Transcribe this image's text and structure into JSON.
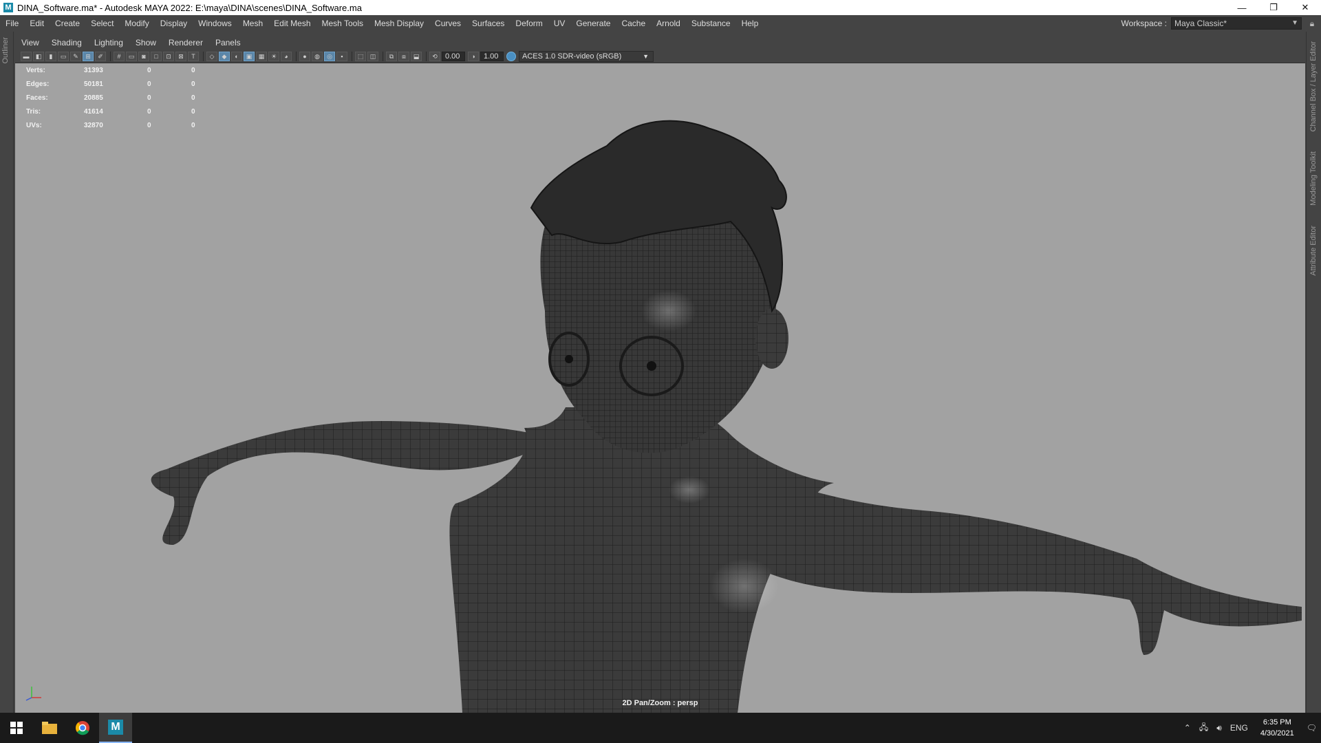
{
  "window": {
    "title": "DINA_Software.ma* - Autodesk MAYA 2022: E:\\maya\\DINA\\scenes\\DINA_Software.ma",
    "app_icon": "maya-icon",
    "minimize": "—",
    "restore": "❐",
    "close": "✕"
  },
  "menubar": {
    "items": [
      "File",
      "Edit",
      "Create",
      "Select",
      "Modify",
      "Display",
      "Windows",
      "Mesh",
      "Edit Mesh",
      "Mesh Tools",
      "Mesh Display",
      "Curves",
      "Surfaces",
      "Deform",
      "UV",
      "Generate",
      "Cache",
      "Arnold",
      "Substance",
      "Help"
    ],
    "workspace_label": "Workspace :",
    "workspace_value": "Maya Classic*"
  },
  "side_tabs": {
    "left": "Outliner",
    "right": [
      "Channel Box / Layer Editor",
      "Modeling Toolkit",
      "Attribute Editor"
    ]
  },
  "panel": {
    "menu": [
      "View",
      "Shading",
      "Lighting",
      "Show",
      "Renderer",
      "Panels"
    ],
    "exposure": "0.00",
    "gamma": "1.00",
    "color_space": "ACES 1.0 SDR-video (sRGB)"
  },
  "hud": {
    "rows": [
      {
        "label": "Verts:",
        "v1": "31393",
        "v2": "0",
        "v3": "0"
      },
      {
        "label": "Edges:",
        "v1": "50181",
        "v2": "0",
        "v3": "0"
      },
      {
        "label": "Faces:",
        "v1": "20885",
        "v2": "0",
        "v3": "0"
      },
      {
        "label": "Tris:",
        "v1": "41614",
        "v2": "0",
        "v3": "0"
      },
      {
        "label": "UVs:",
        "v1": "32870",
        "v2": "0",
        "v3": "0"
      }
    ]
  },
  "viewport": {
    "camera_label": "2D Pan/Zoom : persp",
    "background": "#a2a2a2",
    "mesh_color": "#3a3a3a",
    "wire_color": "#1e1e1e"
  },
  "taskbar": {
    "language": "ENG",
    "time": "6:35 PM",
    "date": "4/30/2021"
  }
}
